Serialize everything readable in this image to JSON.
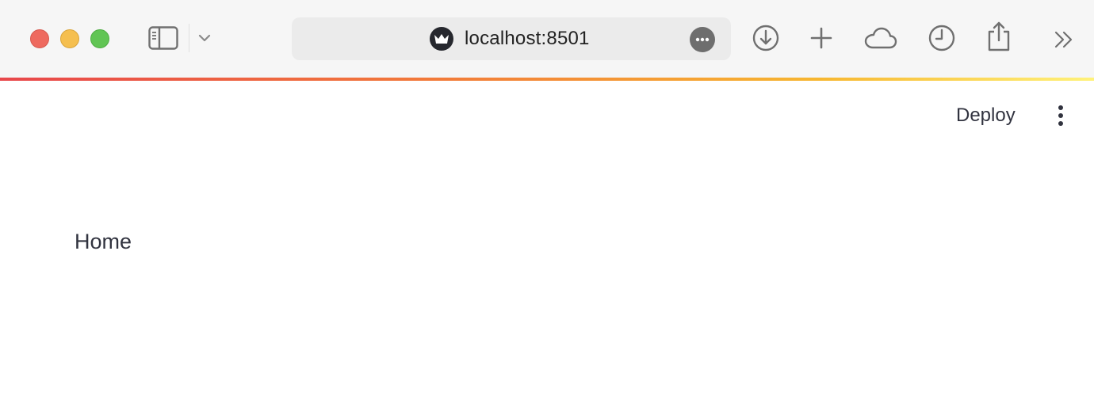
{
  "browser": {
    "url": "localhost:8501"
  },
  "app": {
    "deploy_label": "Deploy",
    "content_text": "Home"
  },
  "colors": {
    "accent_gradient": [
      "#e8474b",
      "#f27b3a",
      "#f7b731",
      "#fff27a"
    ],
    "text": "#31333f"
  },
  "icons": {
    "sidebar": "sidebar-icon",
    "tab_group_menu": "chevron-down-icon",
    "site": "streamlit-crown-icon",
    "page_menu": "ellipsis-icon",
    "downloads": "download-icon",
    "new_tab": "plus-icon",
    "icloud_tabs": "cloud-icon",
    "history": "clock-icon",
    "share": "share-icon",
    "overflow": "double-chevron-right-icon",
    "app_menu": "kebab-icon"
  }
}
